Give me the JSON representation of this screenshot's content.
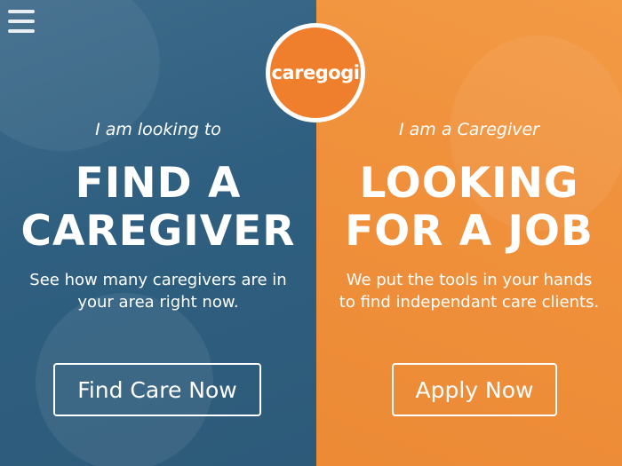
{
  "logo": {
    "text": "caregogi"
  },
  "find_care": {
    "kicker": "I am looking to",
    "headline_line1": "FIND A",
    "headline_line2": "CAREGIVER",
    "sub_line1": "See how many caregivers are in",
    "sub_line2": "your area right now.",
    "button": "Find Care Now"
  },
  "caregiver": {
    "kicker": "I am a Caregiver",
    "headline_line1": "LOOKING",
    "headline_line2": "FOR A JOB",
    "sub_line1": "We put the tools in your hands",
    "sub_line2": "to find independant care clients.",
    "button": "Apply Now"
  },
  "colors": {
    "left_overlay": "#2f5f80",
    "right_overlay": "#f0913c",
    "logo_orange": "#ef7f2c"
  }
}
